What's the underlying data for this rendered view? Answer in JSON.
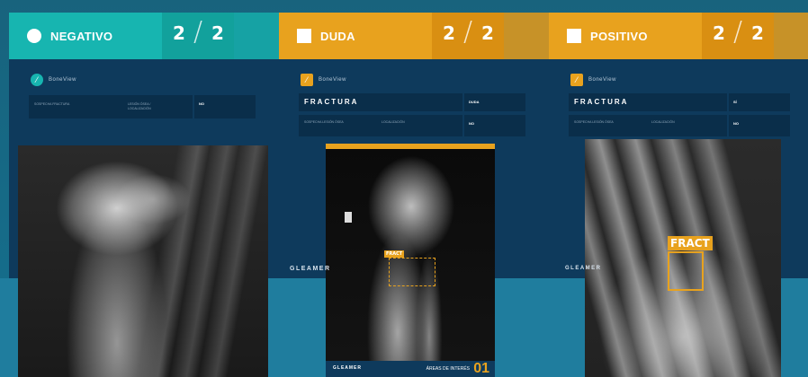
{
  "panels": [
    {
      "status": "NEGATIVO",
      "count_current": "2",
      "count_total": "2",
      "count_cap_left": "",
      "count_cap_right": "",
      "note_title": "",
      "note_text": "",
      "brand": "BoneView",
      "field1_label": "SOSPECHA FRACTURA",
      "field1_label2": "LESIÓN ÓSEA / LOCALIZACIÓN",
      "field1_value": "NO"
    },
    {
      "status": "DUDA",
      "count_current": "2",
      "count_total": "2",
      "note_title": "",
      "brand": "BoneView",
      "title": "FRACTURA",
      "title_value": "DUDA",
      "sub_label": "SOSPECHA LESIÓN ÓSEA",
      "sub_label2": "LOCALIZACIÓN",
      "sub_value": "NO",
      "tag": "FRACT",
      "footer_brand": "GLEAMER",
      "footer_area": "ÁREAS DE INTERÉS",
      "footer_count": "01"
    },
    {
      "status": "POSITIVO",
      "count_current": "2",
      "count_total": "2",
      "brand": "BoneView",
      "title": "FRACTURA",
      "title_value": "SÍ",
      "sub_label": "SOSPECHA LESIÓN ÓSEA",
      "sub_label2": "LOCALIZACIÓN",
      "sub_value": "NO",
      "tag": "FRACT",
      "footer_brand": "GLEAMER"
    }
  ],
  "colors": {
    "teal": "#17b5b0",
    "orange": "#e8a21e",
    "navy": "#0e3a5c"
  }
}
